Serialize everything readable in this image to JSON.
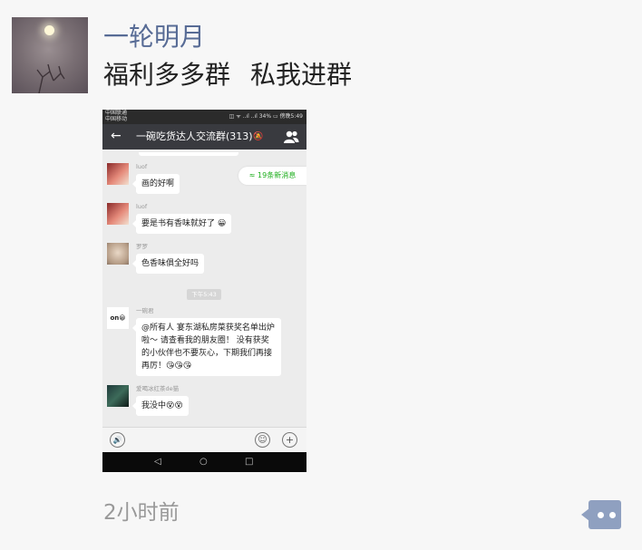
{
  "post": {
    "author": "一轮明月",
    "text_part1": "福利多多群",
    "text_part2": "私我进群",
    "time": "2小时前",
    "more_icon": "comment-more-icon"
  },
  "screenshot": {
    "status": {
      "carrier1": "中国联通",
      "carrier2": "中国移动",
      "right": "◫ ᯤ ..ıl ..ıl 34% ▭ 傍晚5:49"
    },
    "chat_title": "一碗吃货达人交流群(313)",
    "back_icon": "back-arrow-icon",
    "mute_icon": "mute-icon",
    "members_icon": "group-members-icon",
    "new_messages": "≈ 19条新消息",
    "messages": [
      {
        "name": "luof",
        "text": "画的好啊"
      },
      {
        "name": "luof",
        "text": "要是书有香味就好了 😀"
      },
      {
        "name": "罗罗",
        "text": "色香味俱全好吗"
      },
      {
        "name": "一碗君",
        "text": "@所有人 宴东湖私房菜获奖名单出炉啦～ 请查看我的朋友圈！ 没有获奖的小伙伴也不要灰心，下期我们再接再厉！😘😘😘"
      },
      {
        "name": "爱喝冰红茶de猫",
        "text": "我没中😵😵"
      }
    ],
    "time_chip": "下午5:43",
    "avatar_logo": "on😀",
    "voice_icon": "voice-icon",
    "emoji_icon": "emoji-icon",
    "plus_icon": "plus-icon",
    "nav": {
      "back": "◁",
      "home": "○",
      "recent": "□"
    }
  }
}
